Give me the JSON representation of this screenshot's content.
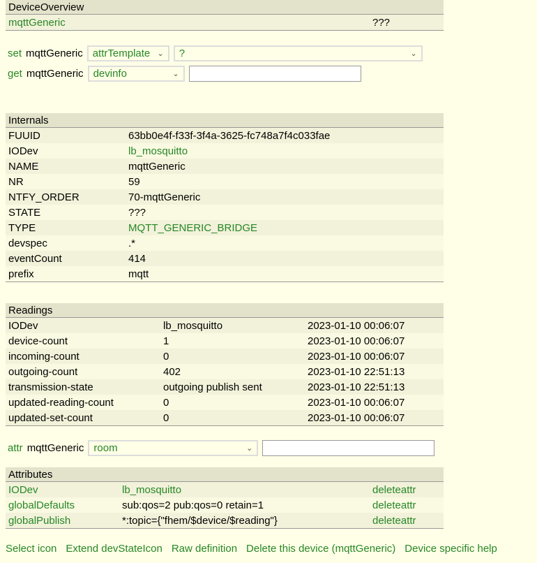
{
  "overview": {
    "title": "DeviceOverview",
    "device": "mqttGeneric",
    "state": "???"
  },
  "set": {
    "label": "set",
    "device": "mqttGeneric",
    "select": "attrTemplate",
    "value": "?"
  },
  "get": {
    "label": "get",
    "device": "mqttGeneric",
    "select": "devinfo",
    "value": ""
  },
  "internals": {
    "title": "Internals",
    "rows": [
      [
        "FUUID",
        "63bb0e4f-f33f-3f4a-3625-fc748a7f4c033fae"
      ],
      [
        "IODev",
        "lb_mosquitto"
      ],
      [
        "NAME",
        "mqttGeneric"
      ],
      [
        "NR",
        "59"
      ],
      [
        "NTFY_ORDER",
        "70-mqttGeneric"
      ],
      [
        "STATE",
        "???"
      ],
      [
        "TYPE",
        "MQTT_GENERIC_BRIDGE"
      ],
      [
        "devspec",
        ".*"
      ],
      [
        "eventCount",
        "414"
      ],
      [
        "prefix",
        "mqtt"
      ]
    ]
  },
  "readings": {
    "title": "Readings",
    "rows": [
      [
        "IODev",
        "lb_mosquitto",
        "2023-01-10 00:06:07"
      ],
      [
        "device-count",
        "1",
        "2023-01-10 00:06:07"
      ],
      [
        "incoming-count",
        "0",
        "2023-01-10 00:06:07"
      ],
      [
        "outgoing-count",
        "402",
        "2023-01-10 22:51:13"
      ],
      [
        "transmission-state",
        "outgoing publish sent",
        "2023-01-10 22:51:13"
      ],
      [
        "updated-reading-count",
        "0",
        "2023-01-10 00:06:07"
      ],
      [
        "updated-set-count",
        "0",
        "2023-01-10 00:06:07"
      ]
    ]
  },
  "attr": {
    "label": "attr",
    "device": "mqttGeneric",
    "select": "room",
    "value": ""
  },
  "attributes": {
    "title": "Attributes",
    "rows": [
      [
        "IODev",
        "lb_mosquitto",
        "deleteattr"
      ],
      [
        "globalDefaults",
        "sub:qos=2 pub:qos=0 retain=1",
        "deleteattr"
      ],
      [
        "globalPublish",
        "*:topic={\"fhem/$device/$reading\"}",
        "deleteattr"
      ]
    ]
  },
  "links": [
    "Select icon",
    "Extend devStateIcon",
    "Raw definition",
    "Delete this device (mqttGeneric)",
    "Device specific help"
  ]
}
